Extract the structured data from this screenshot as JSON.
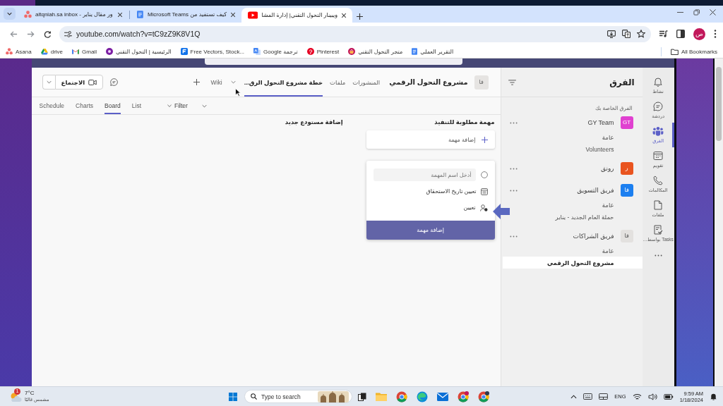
{
  "browser": {
    "tabs": [
      {
        "title": "ويبينار التحول التقني| إدارة المشا",
        "kind": "video",
        "selected": true
      },
      {
        "title": "كيف تستفيد من Microsoft Teams",
        "kind": "document",
        "selected": false
      },
      {
        "title": "altqniah.sa inbox - ور مقال يناير",
        "kind": "dots",
        "selected": false
      }
    ],
    "url": "youtube.com/watch?v=tC9zZ9K8V1Q",
    "profile_initial": "ص",
    "bookmarks": [
      {
        "label": "التقرير العملي",
        "kind": "document"
      },
      {
        "label": "متجر التحول التقني",
        "kind": "basket"
      },
      {
        "label": "Pinterest",
        "kind": "pin"
      },
      {
        "label": "Google ترجمة",
        "kind": "translate"
      },
      {
        "label": "Free Vectors, Stock...",
        "kind": "square"
      },
      {
        "label": "الرئيسية | التحول التقني",
        "kind": "badge"
      },
      {
        "label": "Gmail",
        "kind": "mail"
      },
      {
        "label": "drive",
        "kind": "drive"
      },
      {
        "label": "Asana",
        "kind": "dots"
      }
    ],
    "all_bookmarks": "All Bookmarks"
  },
  "teams": {
    "rail": [
      {
        "label": "نشاط",
        "kind": "bell",
        "selected": false
      },
      {
        "label": "دردشة",
        "kind": "chat",
        "selected": false
      },
      {
        "label": "الفرق",
        "kind": "teams",
        "selected": true
      },
      {
        "label": "تقويم",
        "kind": "calendar",
        "selected": false
      },
      {
        "label": "المكالمات",
        "kind": "call",
        "selected": false
      },
      {
        "label": "ملفات",
        "kind": "file",
        "selected": false
      },
      {
        "label": "Tasks بواسط…",
        "kind": "tasks",
        "selected": false
      }
    ],
    "panel": {
      "title": "الفرق",
      "section": "الفرق الخاصة بك",
      "teams": [
        {
          "name": "GY Team",
          "initials": "GT",
          "color": "#e040d0",
          "channels": [
            {
              "name": "عامة",
              "selected": false
            },
            {
              "name": "Volunteers",
              "selected": false
            }
          ]
        },
        {
          "name": "رونق",
          "initials": "ر",
          "color": "#e9541f"
        },
        {
          "name": "فريق التسويق",
          "initials": "فا",
          "color": "#1c7ff0",
          "channels": [
            {
              "name": "عامة",
              "selected": false
            },
            {
              "name": "حملة العام الجديد - يناير",
              "selected": false
            }
          ]
        },
        {
          "name": "فريق الشراكات",
          "initials": "فا",
          "color": "#e3e1df",
          "channels": [
            {
              "name": "عامة",
              "selected": false
            },
            {
              "name": "مشروع التحول الرقمي",
              "selected": true
            }
          ]
        }
      ]
    },
    "header": {
      "initials": "فا",
      "title": "مشروع التحول الرقمي",
      "tabs": [
        {
          "label": "المنشورات",
          "selected": false
        },
        {
          "label": "ملفات",
          "selected": false
        },
        {
          "label": "خطة مشروع التحول الرق...",
          "selected": true
        },
        {
          "label": "Wiki",
          "selected": false
        }
      ],
      "meet": "الاجتماع"
    },
    "views": [
      {
        "label": "List",
        "selected": false
      },
      {
        "label": "Board",
        "selected": true
      },
      {
        "label": "Charts",
        "selected": false
      },
      {
        "label": "Schedule",
        "selected": false
      }
    ],
    "filter": "Filter",
    "board": {
      "bucket": "مهمة مطلوبة للتنفيذ",
      "add_task": "إضافة مهمة",
      "new_bucket": "إضافة مستودع جديد",
      "new_task": {
        "placeholder": "أدخل اسم المهمة",
        "due_date": "تعيين تاريخ الاستحقاق",
        "assign": "تعيين",
        "submit": "إضافة مهمة"
      }
    }
  },
  "taskbar": {
    "weather": {
      "badge": "1",
      "temperature": "7°C",
      "condition": "مشمس غالبًا"
    },
    "search": {
      "placeholder": "Type to search"
    },
    "language": "ENG",
    "time": "9:59 AM",
    "date": "1/18/2024"
  }
}
